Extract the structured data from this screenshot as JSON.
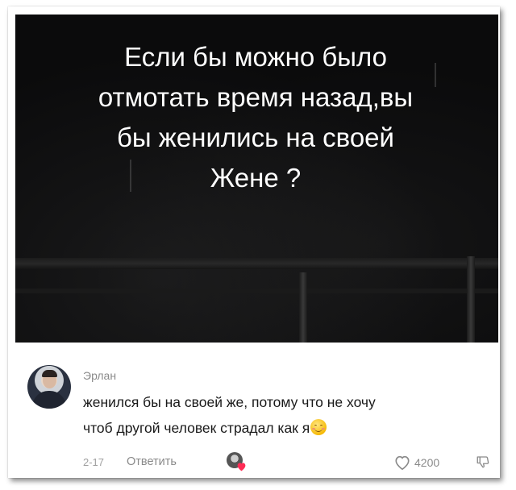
{
  "video": {
    "caption": "Если бы можно было\nотмотать время назад,вы\nбы женились на своей\nЖене ?"
  },
  "comment": {
    "username": "Эрлан",
    "text_line1": "женился бы на своей же, потому что не хочу",
    "text_line2": "чтоб другой человек страдал как я",
    "emoji": "smiling-face-icon",
    "date": "2-17",
    "reply_label": "Ответить",
    "like_count": "4200"
  },
  "colors": {
    "video_background": "#0b0b0c",
    "caption_text": "#ffffff",
    "meta_text": "#8a8a8a",
    "creator_heart": "#fe2c55"
  },
  "icons": {
    "like": "heart-outline-icon",
    "dislike": "thumbs-down-icon",
    "creator_liked": "creator-heart-icon"
  }
}
